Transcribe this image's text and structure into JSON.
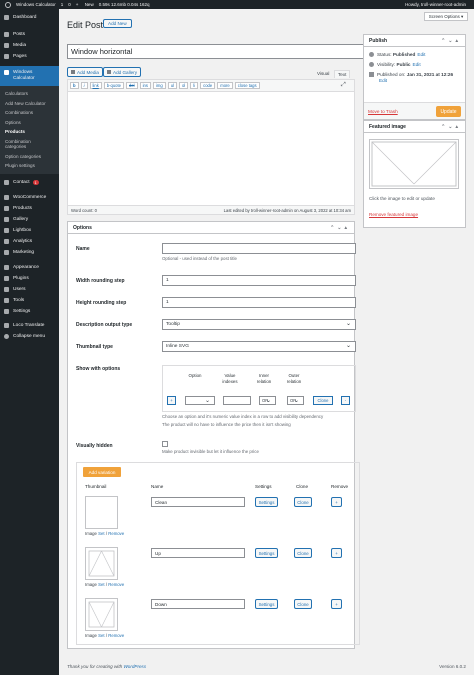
{
  "adminbar": {
    "site": "Windows Calculator",
    "updates": "1",
    "comments": "0",
    "new": "New",
    "perf": "0.59s  12.6mb  0.04s  162q",
    "howdy": "Howdy, troll-winner-root-admin"
  },
  "sidebar": {
    "items_top": [
      "Dashboard",
      "Posts",
      "Media",
      "Pages"
    ],
    "active": "Windows Calculator",
    "submenu": [
      "Calculators",
      "Add New Calculator",
      "Combinations",
      "Options",
      "Products",
      "Combination categories",
      "Option categories",
      "Plugin settings"
    ],
    "current_sub": "Products",
    "items_bottom": [
      "Contact",
      "WooCommerce",
      "Products",
      "Gallery",
      "Lightbox",
      "Analytics",
      "Marketing",
      "Appearance",
      "Plugins",
      "Users",
      "Tools",
      "Settings",
      "Loco Translate",
      "Collapse menu"
    ],
    "contact_badge": "1"
  },
  "header": {
    "title": "Edit Post",
    "add_new": "Add New",
    "screen_options": "Screen Options ▾"
  },
  "post": {
    "title": "Window horizontal"
  },
  "editor": {
    "add_media": "Add Media",
    "add_gallery": "Add Gallery",
    "tab_visual": "Visual",
    "tab_text": "Text",
    "quicktags": [
      "b",
      "i",
      "link",
      "b-quote",
      "del",
      "ins",
      "img",
      "ul",
      "ol",
      "li",
      "code",
      "more",
      "close tags"
    ],
    "word_count": "Word count: 0",
    "last_edited": "Last edited by troll-winner-root-admin on August 3, 2022 at 10:34 am"
  },
  "publish": {
    "heading": "Publish",
    "status_label": "Status:",
    "status_value": "Published",
    "edit": "Edit",
    "visibility_label": "Visibility:",
    "visibility_value": "Public",
    "published_label": "Published on:",
    "published_value": "Jan 31, 2021 at 12:26",
    "trash": "Move to Trash",
    "update": "Update"
  },
  "featured": {
    "heading": "Featured image",
    "help": "Click the image to edit or update",
    "remove": "Remove featured image"
  },
  "options": {
    "heading": "Options",
    "name_label": "Name",
    "name_help": "Optional - used instead of the post title",
    "w_label": "Width rounding step",
    "w_value": "1",
    "h_label": "Height rounding step",
    "h_value": "1",
    "desc_label": "Description output type",
    "desc_value": "Tooltip",
    "thumb_label": "Thumbnail type",
    "thumb_value": "Inline SVG",
    "show_label": "Show with options",
    "show_cols": [
      "Option",
      "Value indexes",
      "Inner relation",
      "Outer relation"
    ],
    "show_add": "+",
    "show_inner": "OR",
    "show_outer": "OR",
    "show_clone": "Clone",
    "show_remove": "-",
    "show_help1": "Choose an option and it's numeric value index in a row to add visibility dependency",
    "show_help2": "The product will no have to influence the price then it isn't showing",
    "hidden_label": "Visually hidden",
    "hidden_help": "Make product invisible but let it influence the price",
    "add_variation": "Add variation",
    "var_cols": [
      "Thumbnail",
      "Name",
      "Settings",
      "Clone",
      "Remove"
    ],
    "img_text": "Image",
    "set": "Set",
    "slash": "/",
    "remove_link": "Remove",
    "settings_btn": "Settings",
    "clone_btn": "Clone",
    "remove_btn": "+",
    "variations": [
      {
        "name": "Clean"
      },
      {
        "name": "Up"
      },
      {
        "name": "Down"
      }
    ]
  },
  "footer": {
    "thanks": "Thank you for creating with",
    "wp": "WordPress",
    "version": "Version 6.0.2"
  }
}
